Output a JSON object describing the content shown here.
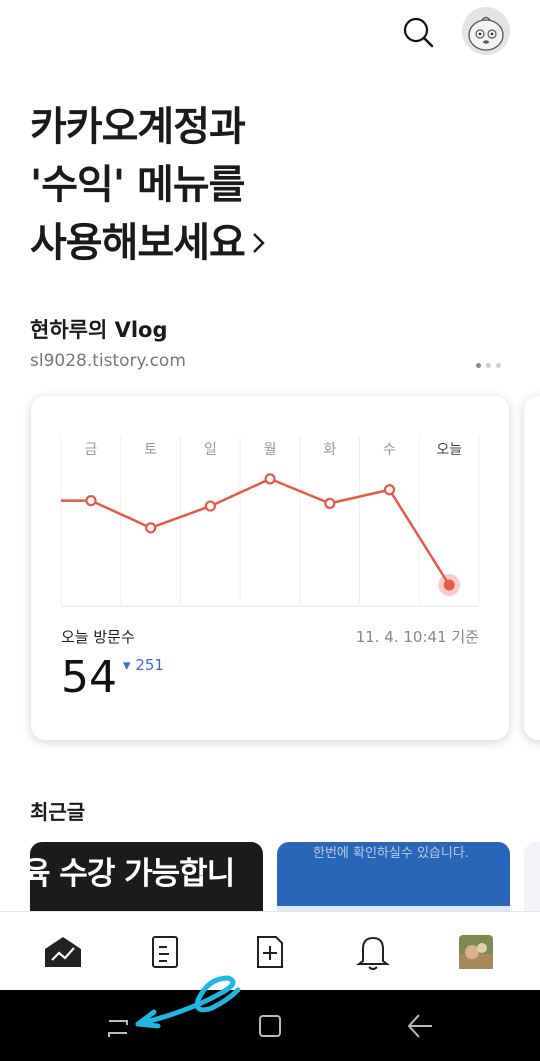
{
  "header": {
    "search_icon": "search-icon",
    "avatar_icon": "kakao-character-avatar"
  },
  "hero": {
    "line1": "카카오계정과",
    "line2": "'수익' 메뉴를",
    "line3": "사용해보세요"
  },
  "blog": {
    "name": "현하루의 Vlog",
    "url": "sl9028.tistory.com"
  },
  "stats": {
    "visit_label": "오늘 방문수",
    "time_label": "11. 4. 10:41 기준",
    "count": "54",
    "delta": "251",
    "delta_color": "#3d6bd6"
  },
  "chart_data": {
    "type": "line",
    "categories": [
      "금",
      "토",
      "일",
      "월",
      "화",
      "수",
      "오늘"
    ],
    "values": [
      38,
      28,
      36,
      46,
      37,
      42,
      7
    ],
    "line_color": "#e85a48",
    "grid": true
  },
  "recent": {
    "title": "최근글",
    "post1_text": "육 수강 가능합니",
    "post2_text": "한번에 확인하실수 있습니다."
  },
  "tabs": [
    "stats-icon",
    "posts-icon",
    "new-post-icon",
    "bell-icon",
    "profile-photo-icon"
  ],
  "system_nav": [
    "recent-apps-icon",
    "home-icon",
    "back-icon"
  ]
}
